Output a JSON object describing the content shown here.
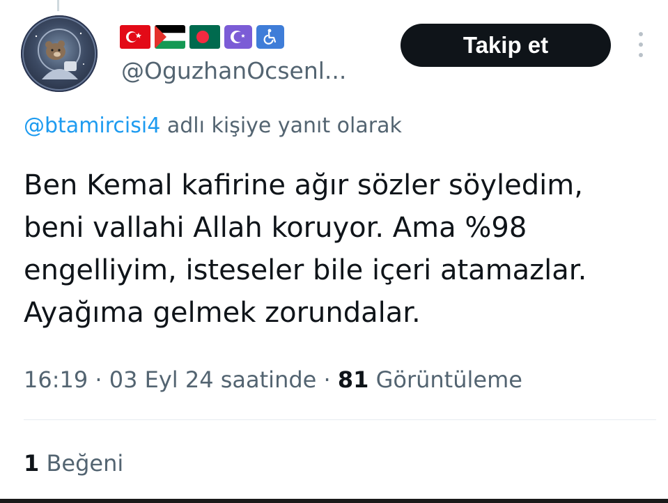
{
  "profile": {
    "handle": "@OguzhanOcsenl...",
    "avatar_icon": "astronaut-bear-avatar",
    "badges": [
      {
        "icon": "turkey-flag-icon",
        "color": "#e30a17"
      },
      {
        "icon": "palestine-flag-icon",
        "color": "#149954"
      },
      {
        "icon": "bangladesh-flag-icon",
        "color": "#006a4e"
      },
      {
        "icon": "star-and-crescent-icon",
        "color": "#7b5cd6"
      },
      {
        "icon": "wheelchair-symbol-icon",
        "color": "#3f7dd8"
      }
    ]
  },
  "actions": {
    "follow_label": "Takip et",
    "more_icon": "more-vertical-icon"
  },
  "reply": {
    "mention": "@btamircisi4",
    "suffix": " adlı kişiye yanıt olarak"
  },
  "tweet": {
    "lines": [
      "Ben Kemal kafirine ağır sözler söyledim,",
      "beni vallahi Allah koruyor. Ama %98",
      "engelliyim, isteseler bile içeri atamazlar.",
      "Ayağıma gelmek zorundalar."
    ]
  },
  "meta": {
    "time": "16:19",
    "sep1": " · ",
    "date": "03 Eyl 24 saatinde",
    "sep2": " · ",
    "views_count": "81",
    "views_label": " Görüntüleme"
  },
  "engagement": {
    "likes_count": "1",
    "likes_label": " Beğeni"
  },
  "colors": {
    "accent": "#1d9bf0",
    "follow_bg": "#0f1419",
    "secondary_text": "#536471",
    "primary_text": "#0f1419"
  }
}
